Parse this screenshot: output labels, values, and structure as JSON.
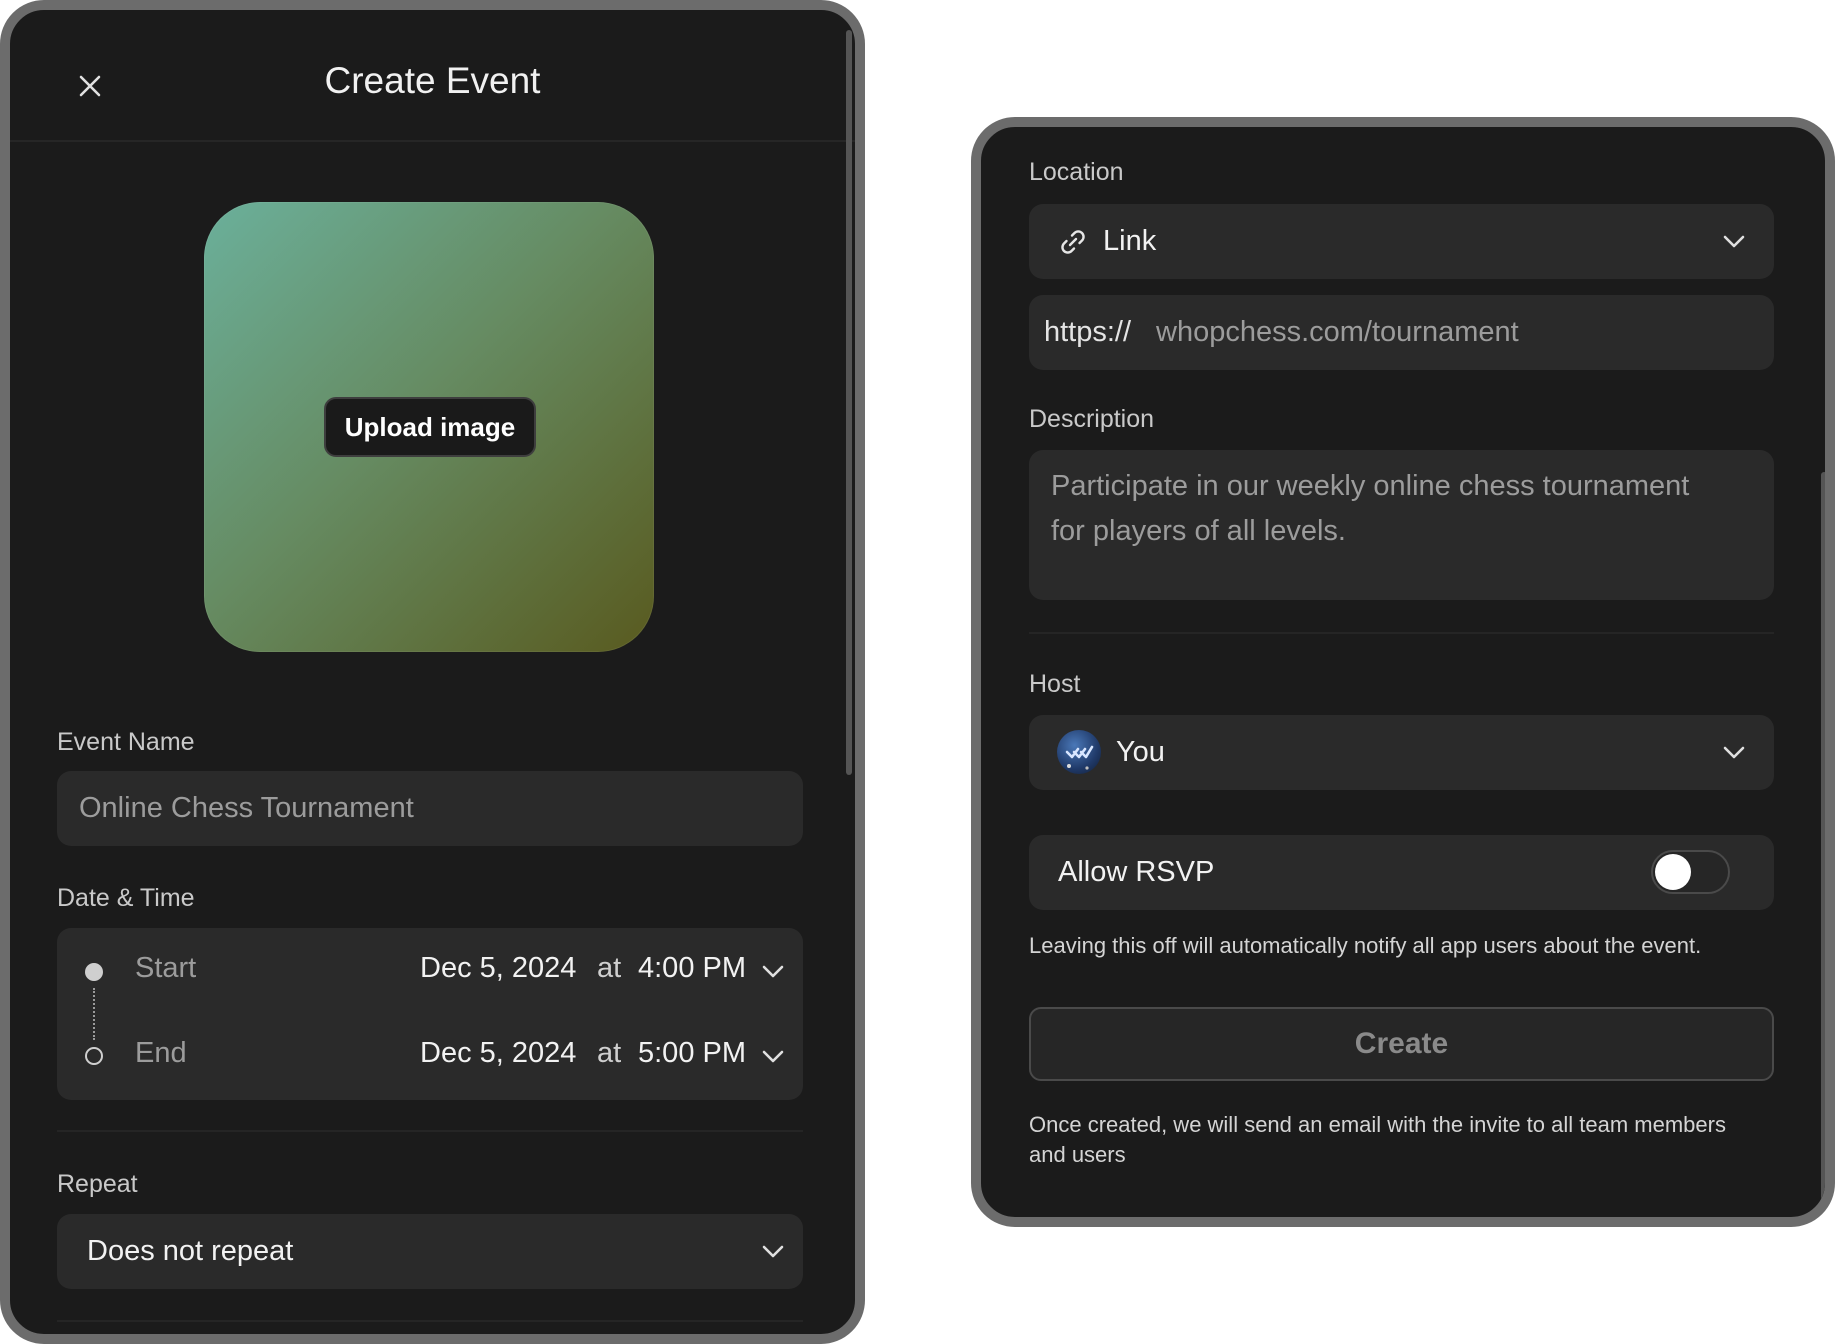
{
  "left_panel": {
    "title": "Create Event",
    "close_icon": "close-icon",
    "upload_label": "Upload image",
    "event_name": {
      "label": "Event Name",
      "value": "Online Chess Tournament"
    },
    "date_time": {
      "label": "Date & Time",
      "start": {
        "label": "Start",
        "date": "Dec 5, 2024",
        "at": "at",
        "time": "4:00 PM"
      },
      "end": {
        "label": "End",
        "date": "Dec 5, 2024",
        "at": "at",
        "time": "5:00 PM"
      }
    },
    "repeat": {
      "label": "Repeat",
      "value": "Does not repeat"
    }
  },
  "right_panel": {
    "location": {
      "label": "Location",
      "type": "Link",
      "type_icon": "link-icon",
      "url_prefix": "https://",
      "url_value": "whopchess.com/tournament"
    },
    "description": {
      "label": "Description",
      "line1": "Participate in our weekly online chess tournament",
      "line2": "for players of all levels."
    },
    "host": {
      "label": "Host",
      "value": "You",
      "avatar_icon": "avatar"
    },
    "rsvp": {
      "label": "Allow RSVP",
      "enabled": false,
      "note": "Leaving this off will automatically notify all app users about the event."
    },
    "create": {
      "label": "Create",
      "note_line1": "Once created, we will send an email with the invite to all team members",
      "note_line2": "and users"
    }
  },
  "colors": {
    "panel_bg": "#1b1b1b",
    "field_bg": "#2a2a2a",
    "frame_border": "#6c6c6c",
    "cover_gradient_start": "#6bb09b",
    "cover_gradient_end": "#595a1f"
  }
}
